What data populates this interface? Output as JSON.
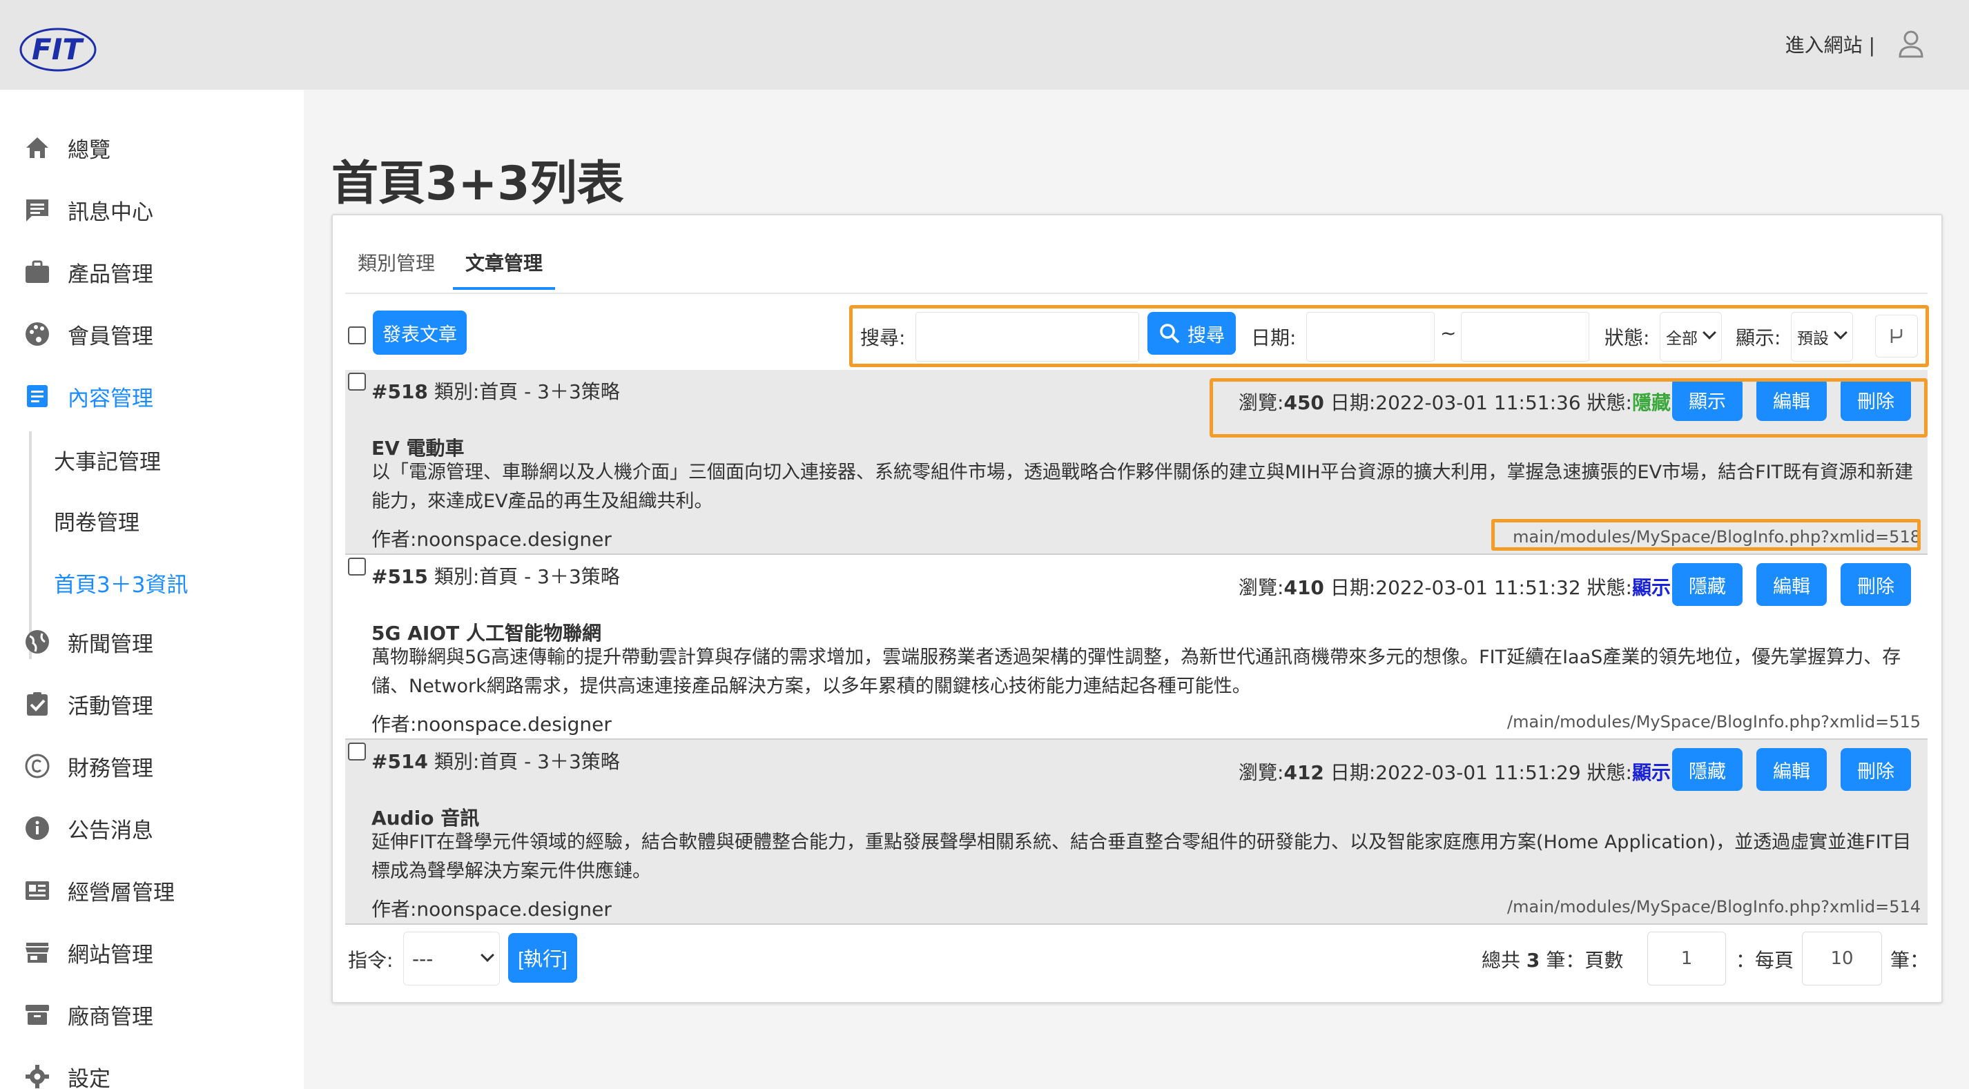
{
  "header": {
    "logo_text": "FIT",
    "enter_site": "進入網站",
    "separator": "|"
  },
  "sidebar": {
    "items": [
      {
        "label": "總覽",
        "icon": "home-icon"
      },
      {
        "label": "訊息中心",
        "icon": "chat-icon"
      },
      {
        "label": "產品管理",
        "icon": "briefcase-icon"
      },
      {
        "label": "會員管理",
        "icon": "palette-icon"
      },
      {
        "label": "內容管理",
        "icon": "document-icon"
      },
      {
        "label": "新聞管理",
        "icon": "globe-icon"
      },
      {
        "label": "活動管理",
        "icon": "clipboard-check-icon"
      },
      {
        "label": "財務管理",
        "icon": "copyright-icon"
      },
      {
        "label": "公告消息",
        "icon": "info-icon"
      },
      {
        "label": "經營層管理",
        "icon": "newspaper-icon"
      },
      {
        "label": "網站管理",
        "icon": "store-icon"
      },
      {
        "label": "廠商管理",
        "icon": "archive-icon"
      },
      {
        "label": "設定",
        "icon": "gear-icon"
      }
    ],
    "sub_items": [
      {
        "label": "大事記管理"
      },
      {
        "label": "問卷管理"
      },
      {
        "label": "首頁3＋3資訊"
      }
    ]
  },
  "page": {
    "title": "首頁3+3列表",
    "tabs": [
      {
        "label": "類別管理"
      },
      {
        "label": "文章管理"
      }
    ]
  },
  "toolbar": {
    "publish_label": "發表文章",
    "search_label": "搜尋:",
    "search_value": "",
    "search_button": "搜尋",
    "date_label": "日期:",
    "date_from": "",
    "date_sep": "~",
    "date_to": "",
    "status_label": "狀態:",
    "status_selected": "全部",
    "display_label": "顯示:",
    "display_selected": "預設"
  },
  "articles": [
    {
      "id": "#518",
      "category": "類別:首頁 - 3＋3策略",
      "views_label": "瀏覽:",
      "views": "450",
      "date": "日期:2022-03-01 11:51:36",
      "status_label": "狀態:",
      "status": "隱藏",
      "toggle_button": "顯示",
      "edit_button": "編輯",
      "delete_button": "刪除",
      "title": "EV 電動車",
      "description": "以「電源管理、車聯網以及人機介面」三個面向切入連接器、系統零組件市場，透過戰略合作夥伴關係的建立與MIH平台資源的擴大利用，掌握急速擴張的EV市場，結合FIT既有資源和新建能力，來達成EV產品的再生及組織共利。",
      "author": "作者:noonspace.designer",
      "url": "main/modules/MySpace/BlogInfo.php?xmlid=518"
    },
    {
      "id": "#515",
      "category": "類別:首頁 - 3＋3策略",
      "views_label": "瀏覽:",
      "views": "410",
      "date": "日期:2022-03-01 11:51:32",
      "status_label": "狀態:",
      "status": "顯示",
      "toggle_button": "隱藏",
      "edit_button": "編輯",
      "delete_button": "刪除",
      "title": "5G AIOT 人工智能物聯網",
      "description": "萬物聯網與5G高速傳輸的提升帶動雲計算與存儲的需求增加，雲端服務業者透過架構的彈性調整，為新世代通訊商機帶來多元的想像。FIT延續在IaaS產業的領先地位，優先掌握算力、存儲、Network網路需求，提供高速連接產品解決方案，以多年累積的關鍵核心技術能力連結起各種可能性。",
      "author": "作者:noonspace.designer",
      "url": "/main/modules/MySpace/BlogInfo.php?xmlid=515"
    },
    {
      "id": "#514",
      "category": "類別:首頁 - 3＋3策略",
      "views_label": "瀏覽:",
      "views": "412",
      "date": "日期:2022-03-01 11:51:29",
      "status_label": "狀態:",
      "status": "顯示",
      "toggle_button": "隱藏",
      "edit_button": "編輯",
      "delete_button": "刪除",
      "title": "Audio 音訊",
      "description": "延伸FIT在聲學元件領域的經驗，結合軟體與硬體整合能力，重點發展聲學相關系統、結合垂直整合零組件的研發能力、以及智能家庭應用方案(Home Application)，並透過虛實並進FIT目標成為聲學解決方案元件供應鏈。",
      "author": "作者:noonspace.designer",
      "url": "/main/modules/MySpace/BlogInfo.php?xmlid=514"
    }
  ],
  "footer": {
    "command_label": "指令:",
    "command_selected": "---",
    "execute_label": "[執行]",
    "total_prefix": "總共",
    "total_count": "3",
    "total_suffix": "筆：頁數",
    "page_value": "1",
    "per_page_label": "：每頁",
    "per_page_value": "10",
    "per_page_suffix": "筆："
  },
  "colors": {
    "accent": "#1a8cff",
    "highlight_border": "#f39c28",
    "status_hidden": "#3aa83a",
    "status_shown": "#1a22d6"
  }
}
